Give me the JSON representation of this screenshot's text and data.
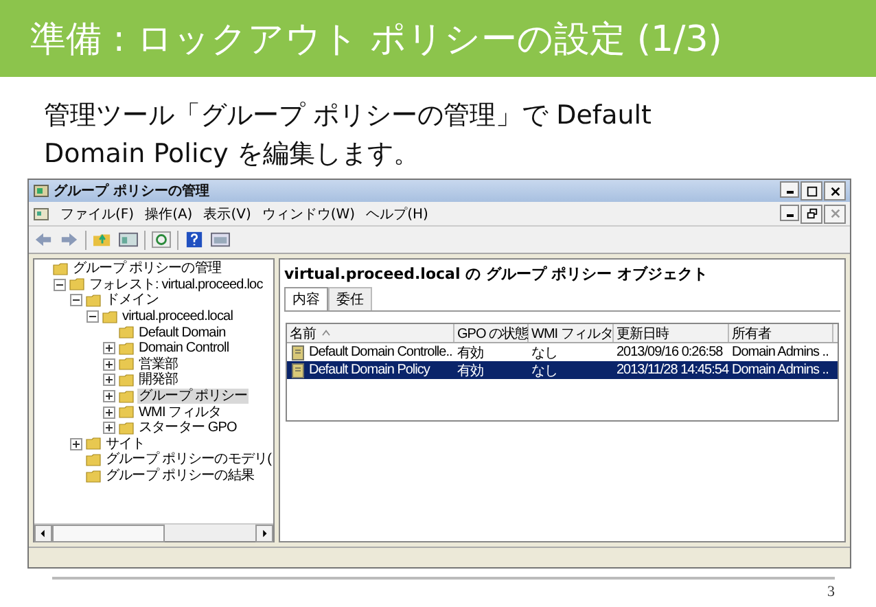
{
  "slide_title": "準備 : ロックアウト ポリシーの設定 (1/3)",
  "body_text": "管理ツール「グループ ポリシーの管理」で Default Domain Policy を編集します。",
  "window": {
    "title": "グループ ポリシーの管理",
    "menu": [
      "ファイル(F)",
      "操作(A)",
      "表示(V)",
      "ウィンドウ(W)",
      "ヘルプ(H)"
    ],
    "tree": [
      {
        "label": "グループ ポリシーの管理",
        "children": [
          {
            "label": "フォレスト: virtual.proceed.loc",
            "expanded": true,
            "children": [
              {
                "label": "ドメイン",
                "expanded": true,
                "children": [
                  {
                    "label": "virtual.proceed.local",
                    "expanded": true,
                    "children": [
                      {
                        "label": "Default Domain",
                        "selected": false
                      },
                      {
                        "label": "Domain Controll",
                        "expanded": false,
                        "selected": false
                      },
                      {
                        "label": "営業部",
                        "expanded": false,
                        "selected": false
                      },
                      {
                        "label": "開発部",
                        "expanded": false,
                        "selected": false
                      },
                      {
                        "label": "グループ ポリシー",
                        "expanded": false,
                        "selected": true
                      },
                      {
                        "label": "WMI フィルタ",
                        "expanded": false,
                        "selected": false
                      },
                      {
                        "label": "スターター GPO",
                        "expanded": false,
                        "selected": false
                      }
                    ]
                  }
                ]
              },
              {
                "label": "サイト",
                "expanded": false,
                "selected": false
              },
              {
                "label": "グループ ポリシーのモデリ(",
                "selected": false
              },
              {
                "label": "グループ ポリシーの結果",
                "selected": false
              }
            ]
          }
        ]
      }
    ],
    "heading": "virtual.proceed.local の グループ ポリシー オブジェクト",
    "tabs": [
      {
        "label": "内容",
        "selected": true
      },
      {
        "label": "委任",
        "selected": false
      }
    ],
    "table": {
      "columns": [
        "名前",
        "GPO の状態",
        "WMI フィルタ",
        "更新日時",
        "所有者"
      ],
      "rows": [
        {
          "cells": [
            "Default Domain Controlle..",
            "有効",
            "なし",
            "2013/09/16 0:26:58",
            "Domain Admins .."
          ],
          "selected": false
        },
        {
          "cells": [
            "Default Domain Policy",
            "有効",
            "なし",
            "2013/11/28 14:45:54",
            "Domain Admins .."
          ],
          "selected": true
        }
      ]
    }
  },
  "page_number": "3"
}
